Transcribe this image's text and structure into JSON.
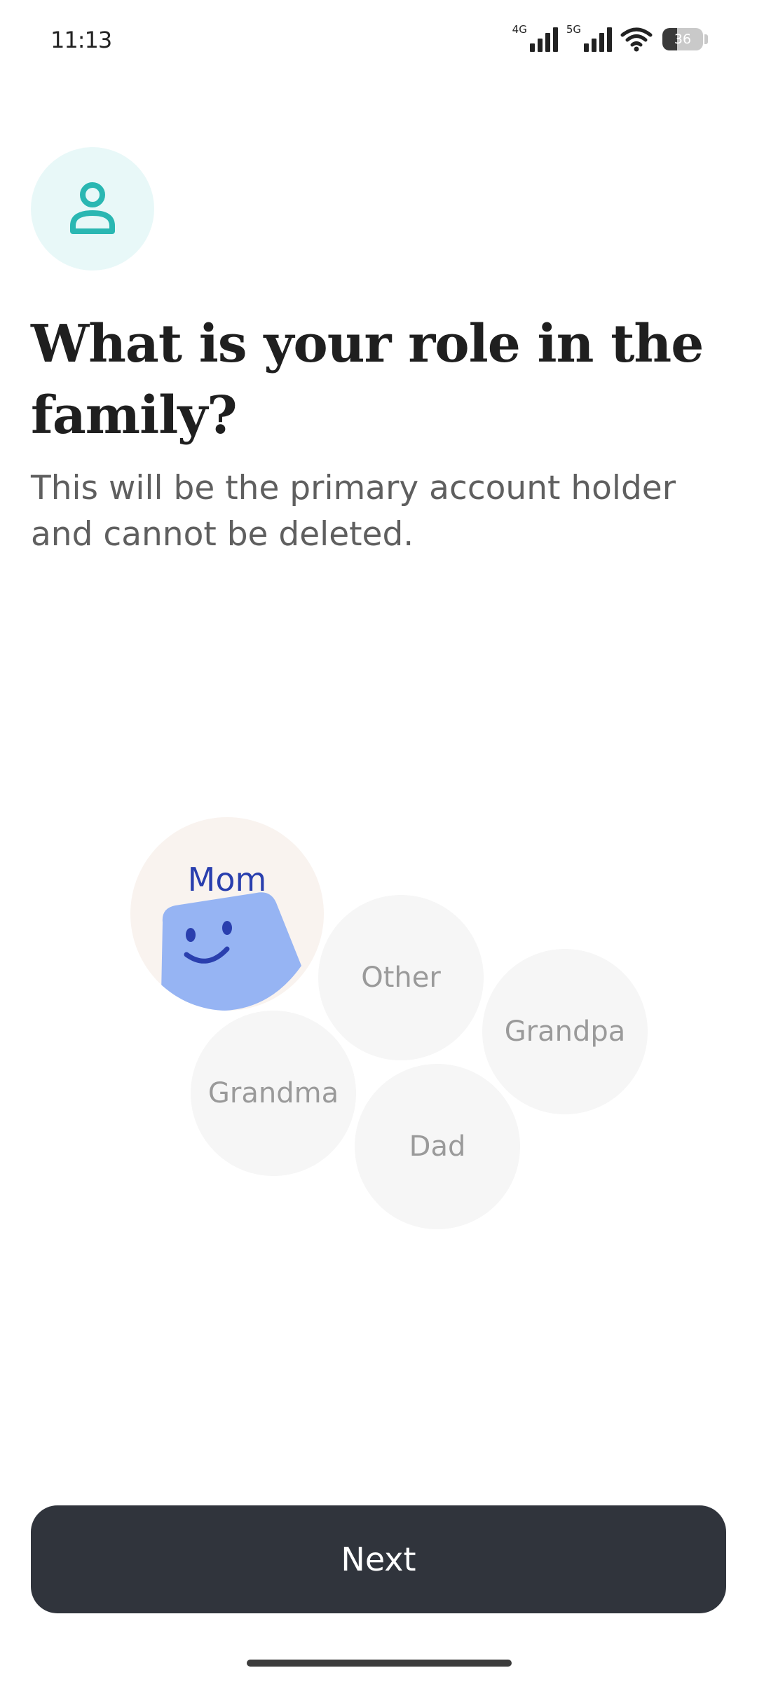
{
  "status_bar": {
    "time": "11:13",
    "network_1": "4G",
    "network_2": "5G",
    "battery_level": 36,
    "battery_text": "36"
  },
  "header": {
    "icon": "person-icon",
    "icon_color": "#2ab7b2",
    "icon_bg": "#e8f8f8",
    "title": "What is your role in the family?",
    "subtitle": "This will be the primary account holder and cannot be deleted."
  },
  "roles": {
    "selected": "Mom",
    "mom": "Mom",
    "other": "Other",
    "grandpa": "Grandpa",
    "grandma": "Grandma",
    "dad": "Dad"
  },
  "colors": {
    "selected_label": "#2a3fae",
    "selected_face": "#96b4f3",
    "button_bg": "#30343c",
    "unselected_bubble": "#f6f6f6"
  },
  "footer": {
    "next_label": "Next"
  }
}
